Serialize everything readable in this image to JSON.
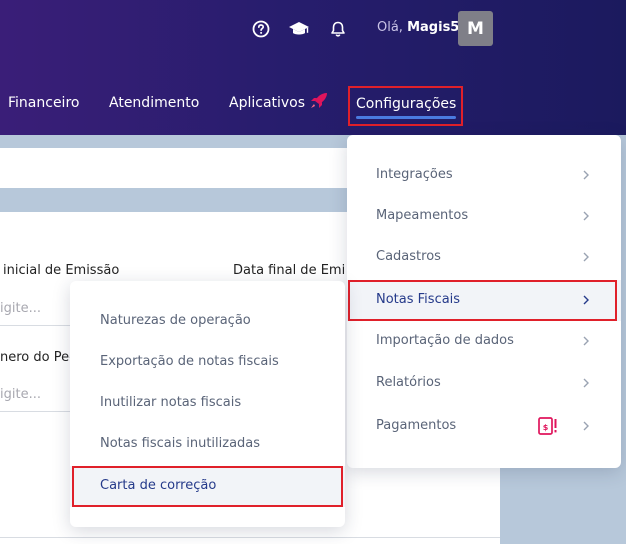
{
  "header": {
    "greeting_prefix": "Olá,",
    "user_name": "Magis5",
    "avatar_letter": "M",
    "icons": [
      "help-icon",
      "graduation-cap-icon",
      "bell-icon"
    ]
  },
  "nav": {
    "financeiro": "Financeiro",
    "atendimento": "Atendimento",
    "aplicativos": "Aplicativos",
    "configuracoes": "Configurações"
  },
  "form": {
    "data_inicial_label": "inicial de Emissão",
    "data_final_label": "Data final de Emi",
    "placeholder_1": "igite...",
    "numero_pedido_label": "nero do Pec",
    "placeholder_2": "igite..."
  },
  "config_menu": {
    "items": [
      {
        "label": "Integrações"
      },
      {
        "label": "Mapeamentos"
      },
      {
        "label": "Cadastros"
      },
      {
        "label": "Notas Fiscais"
      },
      {
        "label": "Importação de dados"
      },
      {
        "label": "Relatórios"
      },
      {
        "label": "Pagamentos"
      }
    ]
  },
  "notas_menu": {
    "items": [
      {
        "label": "Naturezas de operação"
      },
      {
        "label": "Exportação de notas fiscais"
      },
      {
        "label": "Inutilizar notas fiscais"
      },
      {
        "label": "Notas fiscais inutilizadas"
      },
      {
        "label": "Carta de correção"
      }
    ]
  },
  "colors": {
    "header_start": "#3a1e78",
    "header_end": "#1b1a5e",
    "highlight_border": "#e0202a",
    "active_text": "#253a8a",
    "underline": "#4a7be0",
    "badge": "#e0155c"
  }
}
